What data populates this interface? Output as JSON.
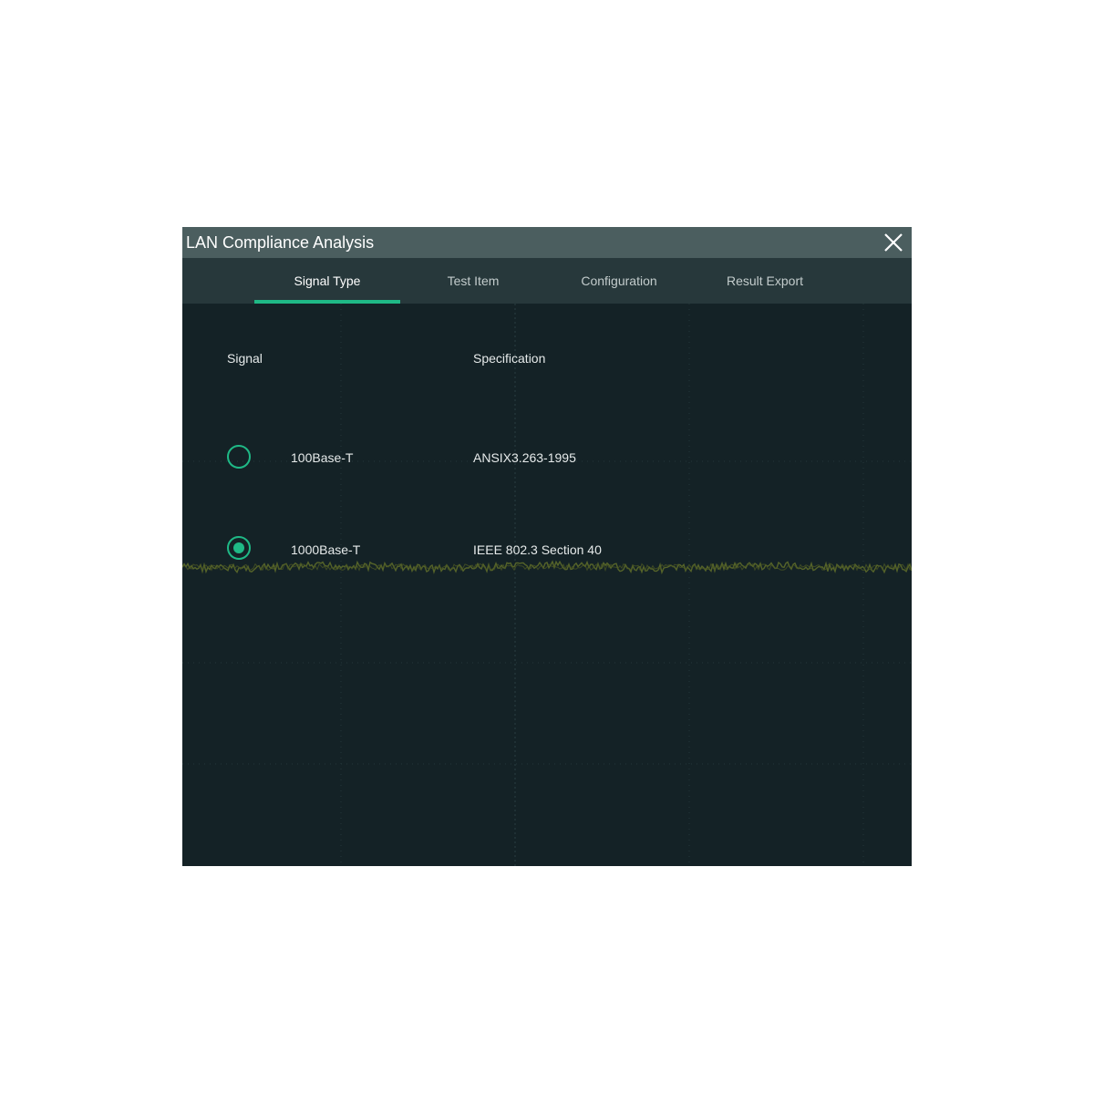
{
  "dialog": {
    "title": "LAN Compliance Analysis",
    "close_icon": "close-icon"
  },
  "tabs": [
    {
      "label": "Signal Type",
      "active": true
    },
    {
      "label": "Test Item",
      "active": false
    },
    {
      "label": "Configuration",
      "active": false
    },
    {
      "label": "Result Export",
      "active": false
    }
  ],
  "table": {
    "headers": {
      "signal": "Signal",
      "specification": "Specification"
    },
    "rows": [
      {
        "signal": "100Base-T",
        "specification": "ANSIX3.263-1995",
        "selected": false
      },
      {
        "signal": "1000Base-T",
        "specification": "IEEE 802.3 Section 40",
        "selected": true
      }
    ]
  },
  "colors": {
    "accent": "#1fb986",
    "title_bar": "#4b5e5f",
    "tab_bar": "#27383b",
    "background": "#142226",
    "waveform": "#5c6a2a"
  }
}
